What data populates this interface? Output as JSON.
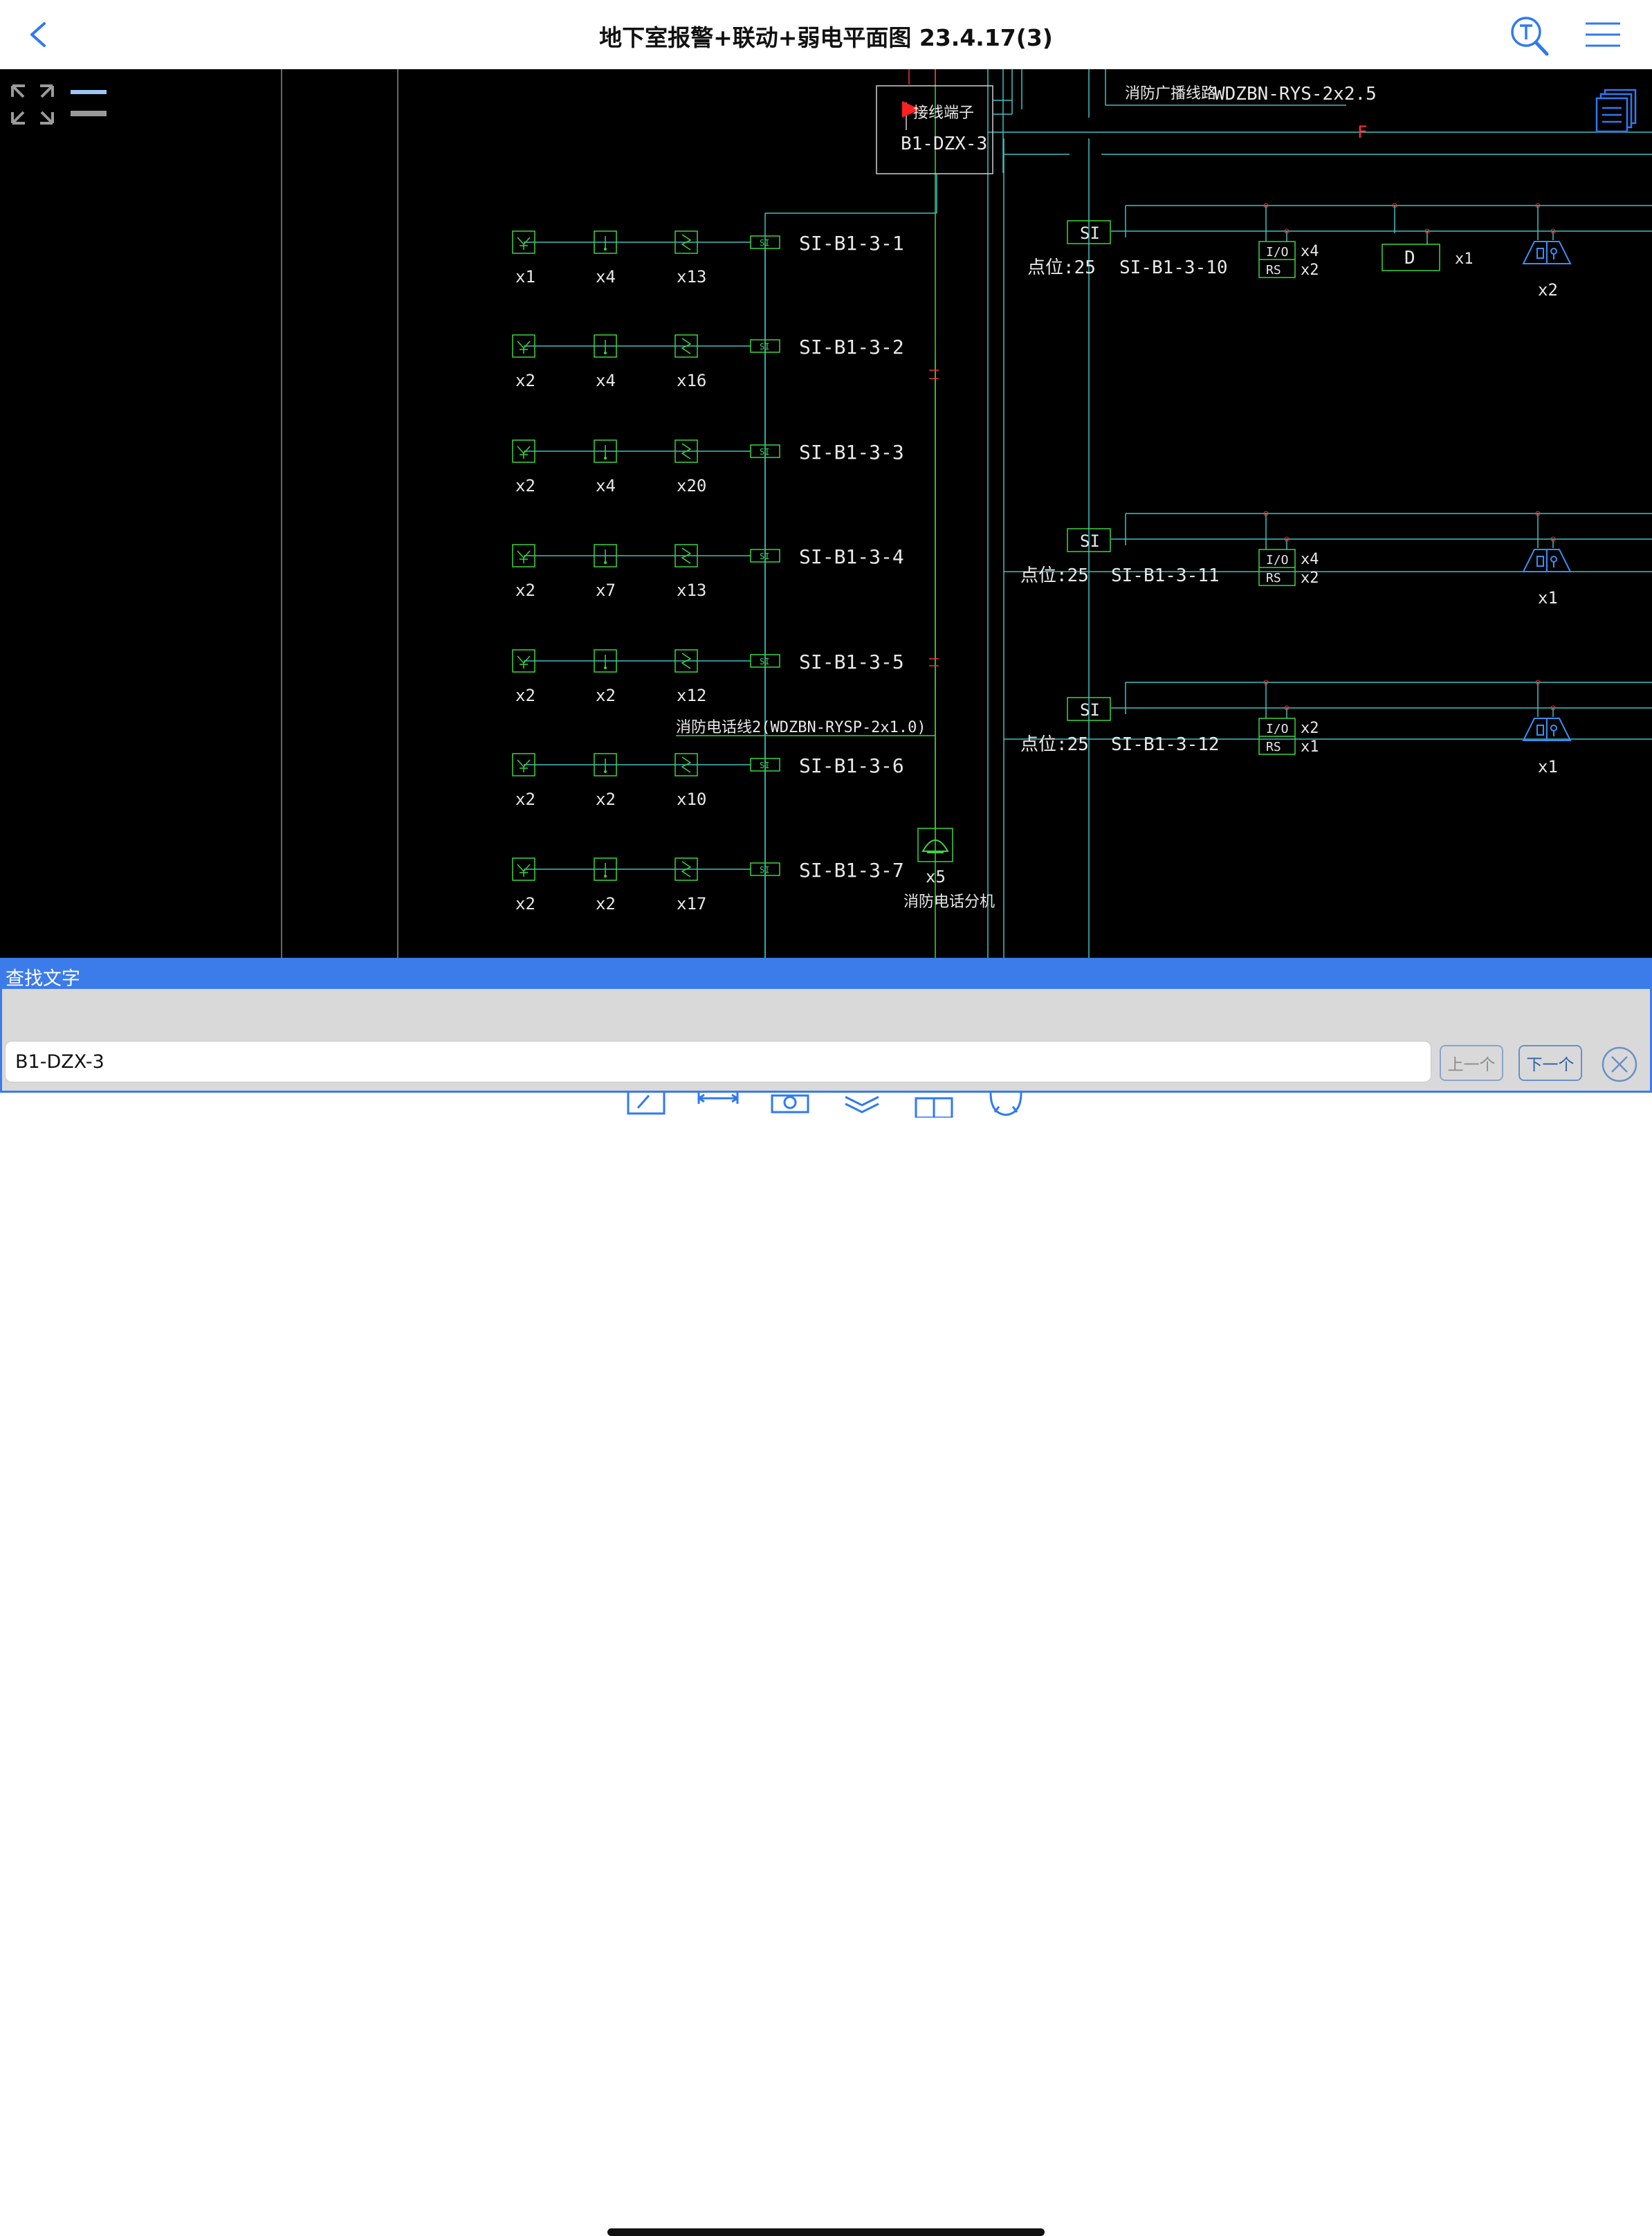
{
  "window": {
    "title": "地下室报警+联动+弱电平面图 23.4.17(3)"
  },
  "drawing": {
    "junction_box": {
      "title": "接线端子",
      "id": "B1-DZX-3"
    },
    "broadcast_line": {
      "label": "消防广播线路",
      "cable": "WDZBN-RYS-2x2.5"
    },
    "fire_line_marker": "F",
    "phone_line_label": "消防电话线2(WDZBN-RYSP-2x1.0)",
    "phone_extension": {
      "count": "x5",
      "label": "消防电话分机"
    },
    "si_label": "SI",
    "left_loops": [
      {
        "name": "SI-B1-3-1",
        "counts": [
          "x1",
          "x4",
          "x13"
        ]
      },
      {
        "name": "SI-B1-3-2",
        "counts": [
          "x2",
          "x4",
          "x16"
        ]
      },
      {
        "name": "SI-B1-3-3",
        "counts": [
          "x2",
          "x4",
          "x20"
        ]
      },
      {
        "name": "SI-B1-3-4",
        "counts": [
          "x2",
          "x7",
          "x13"
        ]
      },
      {
        "name": "SI-B1-3-5",
        "counts": [
          "x2",
          "x2",
          "x12"
        ]
      },
      {
        "name": "SI-B1-3-6",
        "counts": [
          "x2",
          "x2",
          "x10"
        ]
      },
      {
        "name": "SI-B1-3-7",
        "counts": [
          "x2",
          "x2",
          "x17"
        ]
      }
    ],
    "right_loops": [
      {
        "name": "SI-B1-3-10",
        "points": "点位:25",
        "io_count": "x4",
        "rs_count": "x2",
        "d_count": "x1",
        "alarm_count": "x2"
      },
      {
        "name": "SI-B1-3-11",
        "points": "点位:25",
        "io_count": "x4",
        "rs_count": "x2",
        "alarm_count": "x1"
      },
      {
        "name": "SI-B1-3-12",
        "points": "点位:25",
        "io_count": "x2",
        "rs_count": "x1",
        "alarm_count": "x1"
      }
    ],
    "io_label": "I/O",
    "rs_label": "RS",
    "d_label": "D"
  },
  "search": {
    "title": "查找文字",
    "value": "B1-DZX-3",
    "prev_label": "上一个",
    "next_label": "下一个"
  },
  "colors": {
    "accent": "#3b7bea",
    "cad_green": "#3dd43d",
    "cad_cyan": "#40c0c0",
    "cad_red": "#ff3030",
    "cad_blue": "#3b8ef0"
  }
}
